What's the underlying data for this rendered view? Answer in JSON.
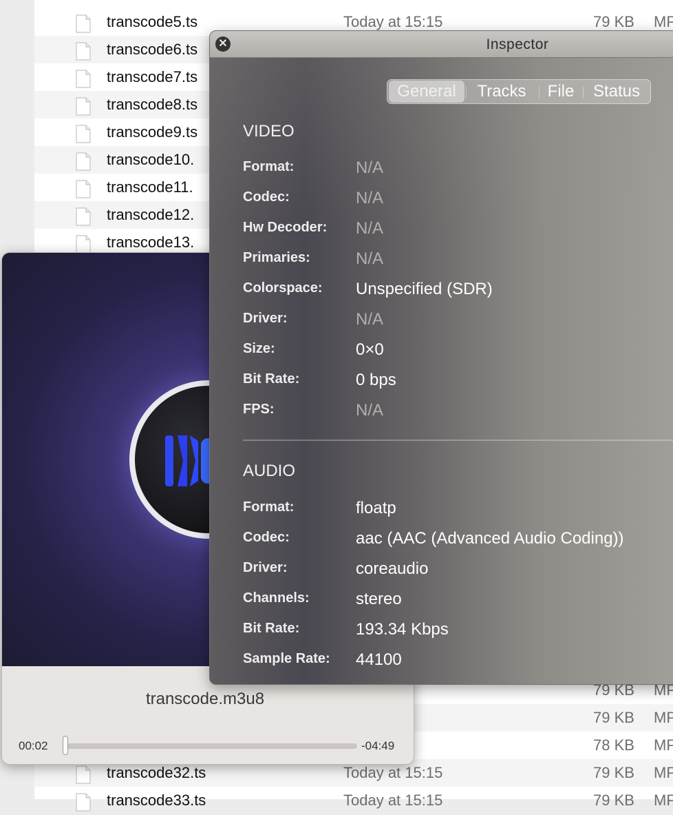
{
  "finder": {
    "rows_top": [
      {
        "name": "transcode5.ts",
        "date": "Today at 15:15",
        "size": "79 KB",
        "kind": "MP"
      },
      {
        "name": "transcode6.ts",
        "date": "",
        "size": "",
        "kind": ""
      },
      {
        "name": "transcode7.ts",
        "date": "",
        "size": "",
        "kind": ""
      },
      {
        "name": "transcode8.ts",
        "date": "",
        "size": "",
        "kind": ""
      },
      {
        "name": "transcode9.ts",
        "date": "",
        "size": "",
        "kind": ""
      },
      {
        "name": "transcode10.",
        "date": "",
        "size": "",
        "kind": ""
      },
      {
        "name": "transcode11.",
        "date": "",
        "size": "",
        "kind": ""
      },
      {
        "name": "transcode12.",
        "date": "",
        "size": "",
        "kind": ""
      },
      {
        "name": "transcode13.",
        "date": "",
        "size": "",
        "kind": ""
      }
    ],
    "rows_bottom": [
      {
        "name": "",
        "date": "15:15",
        "size": "79 KB",
        "kind": "MP"
      },
      {
        "name": "",
        "date": "15:15",
        "size": "79 KB",
        "kind": "MP"
      },
      {
        "name": "",
        "date": "15:15",
        "size": "78 KB",
        "kind": "MP"
      },
      {
        "name": "transcode32.ts",
        "date": "Today at 15:15",
        "size": "79 KB",
        "kind": "MP"
      },
      {
        "name": "transcode33.ts",
        "date": "Today at 15:15",
        "size": "79 KB",
        "kind": "MP"
      }
    ]
  },
  "player": {
    "title": "transcode.m3u8",
    "elapsed": "00:02",
    "remaining": "-04:49",
    "progress": 0.007
  },
  "inspector": {
    "title": "Inspector",
    "close_glyph": "✕",
    "tabs": [
      {
        "label": "General",
        "active": true
      },
      {
        "label": "Tracks",
        "active": false
      },
      {
        "label": "File",
        "active": false
      },
      {
        "label": "Status",
        "active": false
      }
    ],
    "video": {
      "heading": "VIDEO",
      "rows": [
        {
          "label": "Format:",
          "value": "N/A",
          "na": true
        },
        {
          "label": "Codec:",
          "value": "N/A",
          "na": true
        },
        {
          "label": "Hw Decoder:",
          "value": "N/A",
          "na": true
        },
        {
          "label": "Primaries:",
          "value": "N/A",
          "na": true
        },
        {
          "label": "Colorspace:",
          "value": "Unspecified (SDR)",
          "na": false
        },
        {
          "label": "Driver:",
          "value": "N/A",
          "na": true
        },
        {
          "label": "Size:",
          "value": "0×0",
          "na": false
        },
        {
          "label": "Bit Rate:",
          "value": "0 bps",
          "na": false
        },
        {
          "label": "FPS:",
          "value": "N/A",
          "na": true
        }
      ]
    },
    "audio": {
      "heading": "AUDIO",
      "rows": [
        {
          "label": "Format:",
          "value": "floatp",
          "na": false
        },
        {
          "label": "Codec:",
          "value": "aac (AAC (Advanced Audio Coding))",
          "na": false
        },
        {
          "label": "Driver:",
          "value": "coreaudio",
          "na": false
        },
        {
          "label": "Channels:",
          "value": "stereo",
          "na": false
        },
        {
          "label": "Bit Rate:",
          "value": "193.34 Kbps",
          "na": false
        },
        {
          "label": "Sample Rate:",
          "value": "44100",
          "na": false
        }
      ]
    }
  }
}
